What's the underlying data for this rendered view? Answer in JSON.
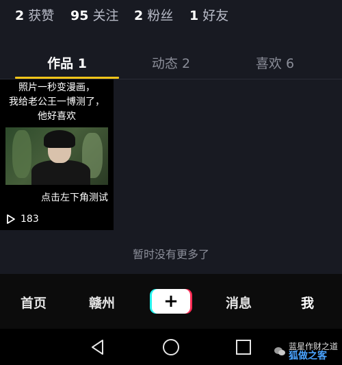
{
  "stats": [
    {
      "num": "2",
      "label": "获赞"
    },
    {
      "num": "95",
      "label": "关注"
    },
    {
      "num": "2",
      "label": "粉丝"
    },
    {
      "num": "1",
      "label": "好友"
    }
  ],
  "tabs": [
    {
      "label": "作品 1"
    },
    {
      "label": "动态 2"
    },
    {
      "label": "喜欢 6"
    }
  ],
  "video": {
    "caption_lines": [
      "照片一秒变漫画，",
      "我给老公王一博测了，",
      "他好喜欢"
    ],
    "bottom_text": "点击左下角测试",
    "plays": "183"
  },
  "no_more": "暂时没有更多了",
  "bottom_nav": {
    "home": "首页",
    "city": "赣州",
    "plus": "+",
    "messages": "消息",
    "me": "我"
  },
  "watermark": {
    "line1": "蓝星作财之道",
    "line2": "狐做之客"
  }
}
